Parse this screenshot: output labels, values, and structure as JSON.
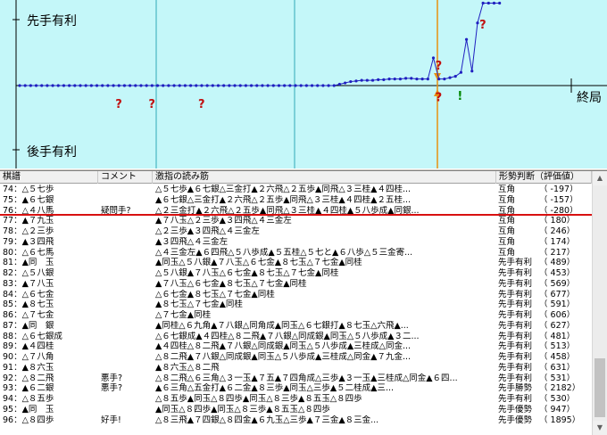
{
  "graph": {
    "label_top": "先手有利",
    "label_bottom": "後手有利",
    "label_end": "終局",
    "markers": [
      {
        "move": 18,
        "value": -0.2,
        "symbol": "?"
      },
      {
        "move": 24,
        "value": -0.2,
        "symbol": "?"
      },
      {
        "move": 33,
        "value": -0.2,
        "symbol": "?"
      },
      {
        "move": 76,
        "value": 0.38,
        "symbol": "?"
      },
      {
        "move": 76,
        "value": -0.1,
        "symbol": "?"
      },
      {
        "move": 80,
        "value": -0.08,
        "symbol": "!"
      },
      {
        "move": 84,
        "value": 1.0,
        "symbol": "?"
      }
    ],
    "series": [
      0,
      0,
      0,
      0,
      0,
      0,
      0,
      0,
      0,
      0,
      0,
      0,
      0,
      0,
      0,
      0,
      0,
      0,
      0,
      0,
      0,
      0,
      0,
      0,
      0,
      0,
      0,
      0,
      0,
      0,
      0,
      0,
      0,
      0,
      0,
      0,
      0,
      0,
      0,
      0,
      0,
      0,
      0,
      0,
      0,
      0,
      0,
      0,
      0,
      0,
      0,
      0,
      0,
      0,
      0,
      0,
      0,
      0,
      0.02,
      0.04,
      0.06,
      0.07,
      0.08,
      0.08,
      0.08,
      0.09,
      0.09,
      0.1,
      0.1,
      0.1,
      0.11,
      0.11,
      0.1,
      0.1,
      0.1,
      0.42,
      0.1,
      0.1,
      0.12,
      0.14,
      0.2,
      0.7,
      0.22,
      0.95,
      1.25,
      1.25,
      1.25,
      1.25
    ],
    "colors": {
      "background": "#c4f7f9",
      "axis": "#000000",
      "line": "#2020c0",
      "cursor": "#e89010",
      "question": "#c01010",
      "good": "#008800"
    }
  },
  "table": {
    "headers": {
      "move": "棋譜",
      "comment": "コメント",
      "line": "激指の読み筋",
      "judge": "形勢判断（評価値）"
    },
    "rows": [
      {
        "move": "74：△５七歩",
        "comment": "",
        "line": "△５七歩▲６七銀△三金打▲２六飛△２五歩▲同飛△３三桂▲４四桂...",
        "judge": "互角",
        "eval": "（ -197）"
      },
      {
        "move": "75：▲６七銀",
        "comment": "",
        "line": "▲６七銀△三金打▲２六飛△２五歩▲同飛△３三桂▲４四桂▲２五桂...",
        "judge": "互角",
        "eval": "（ -157）"
      },
      {
        "move": "76：△４八馬",
        "comment": "疑問手?",
        "line": "△２三金打▲２六飛△２五歩▲同飛△３三桂▲４四桂▲５八歩成▲同銀...",
        "judge": "互角",
        "eval": "（ -280）"
      },
      {
        "move": "77：▲７九玉",
        "comment": "",
        "line": "▲７八玉△２三歩▲３四飛△４三金左",
        "judge": "互角",
        "eval": "（  180）"
      },
      {
        "move": "78：△２三歩",
        "comment": "",
        "line": "△２三歩▲３四飛△４三金左",
        "judge": "互角",
        "eval": "（  246）"
      },
      {
        "move": "79：▲３四飛",
        "comment": "",
        "line": "▲３四飛△４三金左",
        "judge": "互角",
        "eval": "（  174）"
      },
      {
        "move": "80：△６七馬",
        "comment": "",
        "line": "△４三金左▲６四飛△５八歩成▲５五桂△５七と▲６八歩△５三金寄...",
        "judge": "互角",
        "eval": "（  217）"
      },
      {
        "move": "81：▲同　玉",
        "comment": "",
        "line": "▲同玉△５八銀▲７八玉△６七金▲８七玉△７七金▲同桂",
        "judge": "先手有利",
        "eval": "（  489）"
      },
      {
        "move": "82：△５八銀",
        "comment": "",
        "line": "△５八銀▲７八玉△６七金▲８七玉△７七金▲同桂",
        "judge": "先手有利",
        "eval": "（  453）"
      },
      {
        "move": "83：▲７八玉",
        "comment": "",
        "line": "▲７八玉△６七金▲８七玉△７七金▲同桂",
        "judge": "先手有利",
        "eval": "（  569）"
      },
      {
        "move": "84：△６七金",
        "comment": "",
        "line": "△６七金▲８七玉△７七金▲同桂",
        "judge": "先手有利",
        "eval": "（  677）"
      },
      {
        "move": "85：▲８七玉",
        "comment": "",
        "line": "▲８七玉△７七金▲同桂",
        "judge": "先手有利",
        "eval": "（  591）"
      },
      {
        "move": "86：△７七金",
        "comment": "",
        "line": "△７七金▲同桂",
        "judge": "先手有利",
        "eval": "（  606）"
      },
      {
        "move": "87：▲同　銀",
        "comment": "",
        "line": "▲同桂△６九角▲７八銀△同角成▲同玉△６七銀打▲８七玉△六飛▲...",
        "judge": "先手有利",
        "eval": "（  627）"
      },
      {
        "move": "88：△６七銀成",
        "comment": "",
        "line": "△６七銀成▲４四桂△８二飛▲７八銀△同成銀▲同玉△５八歩成▲３二...",
        "judge": "先手有利",
        "eval": "（  481）"
      },
      {
        "move": "89：▲４四桂",
        "comment": "",
        "line": "▲４四桂△８二飛▲７八銀△同成銀▲同玉△５八歩成▲三桂成△同金...",
        "judge": "先手有利",
        "eval": "（  513）"
      },
      {
        "move": "90：△７八角",
        "comment": "",
        "line": "△８二飛▲７八銀△同成銀▲同玉△５八歩成▲三桂成△同金▲７九金...",
        "judge": "先手有利",
        "eval": "（  458）"
      },
      {
        "move": "91：▲８六玉",
        "comment": "",
        "line": "▲８六玉△８二飛",
        "judge": "先手有利",
        "eval": "（  631）"
      },
      {
        "move": "92：△８二飛",
        "comment": "悪手?",
        "line": "△８二飛△６三角△３一玉▲７五▲７四角成△三歩▲３一玉▲三桂成△同金▲６四...",
        "judge": "先手有利",
        "eval": "（  531）"
      },
      {
        "move": "93：▲６二銀",
        "comment": "悪手?",
        "line": "▲６三角△五金打▲６二金▲８三歩▲同玉△三歩▲５二桂成▲三...",
        "judge": "先手勝勢",
        "eval": "（ 2182）"
      },
      {
        "move": "94：△８五歩",
        "comment": "",
        "line": "△８五歩▲同玉△８四歩▲同玉△８三歩▲８五玉△８四歩",
        "judge": "先手有利",
        "eval": "（  530）"
      },
      {
        "move": "95：▲同　玉",
        "comment": "",
        "line": "▲同玉△８四歩▲同玉△８三歩▲８五玉△８四歩",
        "judge": "先手優勢",
        "eval": "（  947）"
      },
      {
        "move": "96：△８四歩",
        "comment": "好手!",
        "line": "△８三飛▲７四銀△８四金▲６九玉△三歩▲７三金▲８三金...",
        "judge": "先手優勢",
        "eval": "（ 1895）"
      }
    ],
    "highlight_row": 2
  },
  "scrollbar": {
    "up_icon": "▲",
    "down_icon": "▼"
  }
}
